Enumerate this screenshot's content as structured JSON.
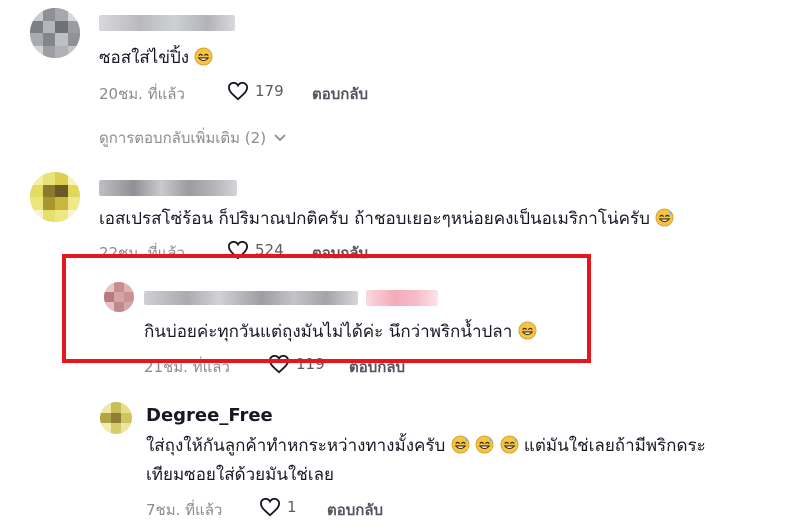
{
  "comments": [
    {
      "text": "ซอสใส่ไข่ปิ้ง",
      "emoji": "grinning-sweat-emoji",
      "time": "20ชม. ที่แล้ว",
      "likes": "179",
      "reply_label": "ตอบกลับ"
    },
    {
      "text": "เอสเปรสโซ่ร้อน ก็ปริมาณปกติครับ ถ้าชอบเยอะๆหน่อยคงเป็นอเมริกาโน่ครับ",
      "emoji": "grinning-sweat-emoji",
      "time": "22ชม. ที่แล้ว",
      "likes": "524",
      "reply_label": "ตอบกลับ"
    }
  ],
  "view_more": {
    "label": "ดูการตอบกลับเพิ่มเติม (2)",
    "icon": "chevron-down-icon"
  },
  "highlighted_reply": {
    "text": "กินบ่อยค่ะทุกวันแต่ถุงมันไม่ได้ค่ะ นึกว่าพริกน้ำปลา",
    "emoji": "grinning-sweat-emoji",
    "time": "21ชม. ที่แล้ว",
    "likes": "119",
    "reply_label": "ตอบกลับ",
    "highlight_color": "#e8141e"
  },
  "reply": {
    "username": "Degree_Free",
    "text_line1": "ใส่ถุงให้กันลูกค้าทำหกระหว่างทางมั้งครับ",
    "text_line1_end": "แต่มันใช่เลยถ้ามีพริกดระ",
    "text_line2": "เทียมซอยใส่ด้วยมันใช่เลย",
    "time": "7ชม. ที่แล้ว",
    "likes": "1",
    "reply_label": "ตอบกลับ"
  }
}
